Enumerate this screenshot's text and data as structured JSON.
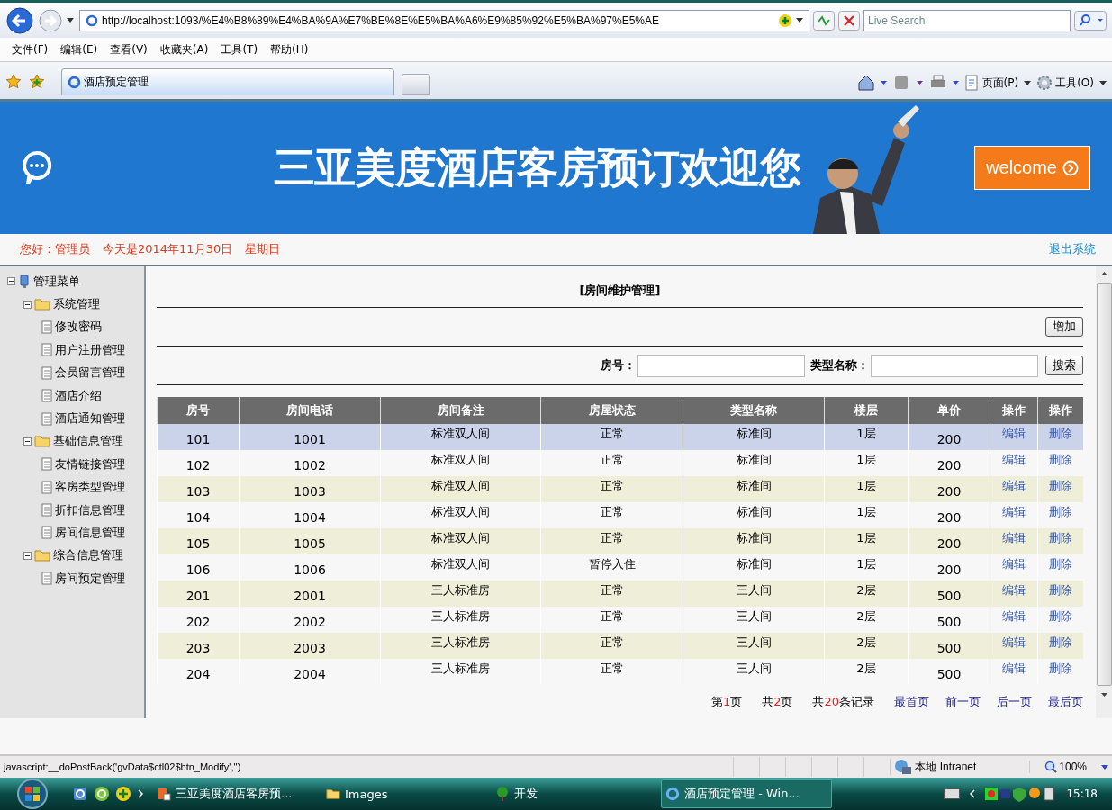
{
  "browser": {
    "address": "http://localhost:1093/%E4%B8%89%E4%BA%9A%E7%BE%8E%E5%BA%A6%E9%85%92%E5%BA%97%E5%AE",
    "search_placeholder": "Live Search",
    "menu": [
      "文件(F)",
      "编辑(E)",
      "查看(V)",
      "收藏夹(A)",
      "工具(T)",
      "帮助(H)"
    ],
    "tab": "酒店预定管理",
    "tools": [
      "页面(P)",
      "工具(O)"
    ]
  },
  "banner": {
    "title": "三亚美度酒店客房预订欢迎您",
    "welcome": "welcome"
  },
  "greeting": {
    "user": "您好：管理员",
    "date": "今天是2014年11月30日",
    "weekday": "星期日",
    "logout": "退出系统"
  },
  "sidebar": {
    "items": [
      {
        "label": "管理菜单",
        "kind": "root",
        "expanded": true,
        "children": [
          {
            "label": "系统管理",
            "kind": "folder",
            "expanded": true,
            "children": [
              {
                "label": "修改密码",
                "kind": "page"
              },
              {
                "label": "用户注册管理",
                "kind": "page"
              },
              {
                "label": "会员留言管理",
                "kind": "page"
              },
              {
                "label": "酒店介绍",
                "kind": "page"
              },
              {
                "label": "酒店通知管理",
                "kind": "page"
              }
            ]
          },
          {
            "label": "基础信息管理",
            "kind": "folder",
            "expanded": true,
            "children": [
              {
                "label": "友情链接管理",
                "kind": "page"
              },
              {
                "label": "客房类型管理",
                "kind": "page"
              },
              {
                "label": "折扣信息管理",
                "kind": "page"
              },
              {
                "label": "房间信息管理",
                "kind": "page"
              }
            ]
          },
          {
            "label": "综合信息管理",
            "kind": "folder",
            "expanded": true,
            "children": [
              {
                "label": "房间预定管理",
                "kind": "page"
              }
            ]
          }
        ]
      }
    ]
  },
  "content": {
    "title": "[房间维护管理]",
    "add_button": "增加",
    "search": [
      {
        "label": "房号："
      },
      {
        "label": "类型名称："
      }
    ],
    "search_button": "搜索"
  },
  "table": {
    "columns": [
      "房号",
      "房间电话",
      "房间备注",
      "房屋状态",
      "类型名称",
      "楼层",
      "单价",
      "操作",
      "操作"
    ],
    "rows": [
      {
        "cells": [
          "101",
          "1001",
          "标准双人间",
          "正常",
          "标准间",
          "1层",
          "200"
        ],
        "edit": "编辑",
        "delete": "删除",
        "selected": true
      },
      {
        "cells": [
          "102",
          "1002",
          "标准双人间",
          "正常",
          "标准间",
          "1层",
          "200"
        ],
        "edit": "编辑",
        "delete": "删除",
        "selected": false
      },
      {
        "cells": [
          "103",
          "1003",
          "标准双人间",
          "正常",
          "标准间",
          "1层",
          "200"
        ],
        "edit": "编辑",
        "delete": "删除",
        "selected": false
      },
      {
        "cells": [
          "104",
          "1004",
          "标准双人间",
          "正常",
          "标准间",
          "1层",
          "200"
        ],
        "edit": "编辑",
        "delete": "删除",
        "selected": false
      },
      {
        "cells": [
          "105",
          "1005",
          "标准双人间",
          "正常",
          "标准间",
          "1层",
          "200"
        ],
        "edit": "编辑",
        "delete": "删除",
        "selected": false
      },
      {
        "cells": [
          "106",
          "1006",
          "标准双人间",
          "暂停入住",
          "标准间",
          "1层",
          "200"
        ],
        "edit": "编辑",
        "delete": "删除",
        "selected": false
      },
      {
        "cells": [
          "201",
          "2001",
          "三人标准房",
          "正常",
          "三人间",
          "2层",
          "500"
        ],
        "edit": "编辑",
        "delete": "删除",
        "selected": false
      },
      {
        "cells": [
          "202",
          "2002",
          "三人标准房",
          "正常",
          "三人间",
          "2层",
          "500"
        ],
        "edit": "编辑",
        "delete": "删除",
        "selected": false
      },
      {
        "cells": [
          "203",
          "2003",
          "三人标准房",
          "正常",
          "三人间",
          "2层",
          "500"
        ],
        "edit": "编辑",
        "delete": "删除",
        "selected": false
      },
      {
        "cells": [
          "204",
          "2004",
          "三人标准房",
          "正常",
          "三人间",
          "2层",
          "500"
        ],
        "edit": "编辑",
        "delete": "删除",
        "selected": false
      }
    ]
  },
  "pager": {
    "stats": [
      {
        "before": "第",
        "value": "1",
        "after": "页"
      },
      {
        "before": "共",
        "value": "2",
        "after": "页"
      },
      {
        "before": "共",
        "value": "20",
        "after": "条记录"
      }
    ],
    "links": [
      "最首页",
      "前一页",
      "后一页",
      "最后页"
    ]
  },
  "status_bar": {
    "text": "javascript:__doPostBack('gvData$ctl02$btn_Modify','')",
    "zone": "本地 Intranet",
    "zoom": "100%"
  },
  "taskbar": {
    "items": [
      {
        "label": "三亚美度酒店客房预...",
        "kind": "app",
        "selected": false
      },
      {
        "label": "Images",
        "kind": "folder",
        "selected": false
      },
      {
        "label": "开发",
        "kind": "tree",
        "selected": false
      },
      {
        "label": "酒店预定管理 - Win...",
        "kind": "browser",
        "selected": true
      }
    ],
    "clock": "15:18"
  }
}
